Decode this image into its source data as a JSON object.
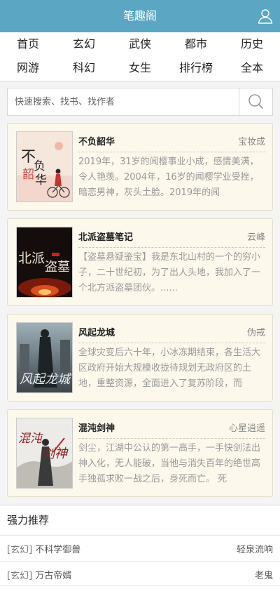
{
  "header": {
    "title": "笔趣阁",
    "user_icon": "user-icon"
  },
  "nav": {
    "row1": [
      "首页",
      "玄幻",
      "武侠",
      "都市",
      "历史"
    ],
    "row2": [
      "网游",
      "科幻",
      "女生",
      "排行榜",
      "全本"
    ]
  },
  "search": {
    "placeholder": "快速搜索、找书、找作者",
    "value": "",
    "icon": "search-icon"
  },
  "books": [
    {
      "title": "不负韶华",
      "author": "宝妆成",
      "desc": "2019年，31岁的闻樱事业小成，感情美满，令人艳羡。2004年，16岁的闻樱学业受挫，暗恋男神，灰头土脸。2019年的闻",
      "cover_text": "不负韶华"
    },
    {
      "title": "北派盗墓笔记",
      "author": "云峰",
      "desc": "【盗墓悬疑鉴宝】我是东北山村的一个的穷小子，二十世纪初，为了出人头地，我加入了一个北方派盗墓团伙。......",
      "cover_text": "北派盗墓"
    },
    {
      "title": "风起龙城",
      "author": "伪戒",
      "desc": "全球灾变后六十年，小冰冻期结束，各生活大区政府开始大规模收拢待规划无政府区的土地，重整资源，全面进入了复苏阶段，而",
      "cover_text": "风起龙城"
    },
    {
      "title": "混沌剑神",
      "author": "心星逍遥",
      "desc": "剑尘，江湖中公认的第一高手，一手快剑法出神入化，无人能破，当他与消失百年的绝世高手独孤求败一战之后，身死而亡。 死",
      "cover_text": "混沌剑神"
    }
  ],
  "recommend": {
    "title": "强力推荐",
    "items": [
      {
        "category": "[玄幻]",
        "name": "不科学御兽",
        "author": "轻泉流响"
      },
      {
        "category": "[玄幻]",
        "name": "万古帝婿",
        "author": "老鬼"
      }
    ]
  },
  "colors": {
    "header_bg": "#5aa6c3",
    "card_bg": "#fcf8ec",
    "page_bg": "#f4f4f4"
  }
}
